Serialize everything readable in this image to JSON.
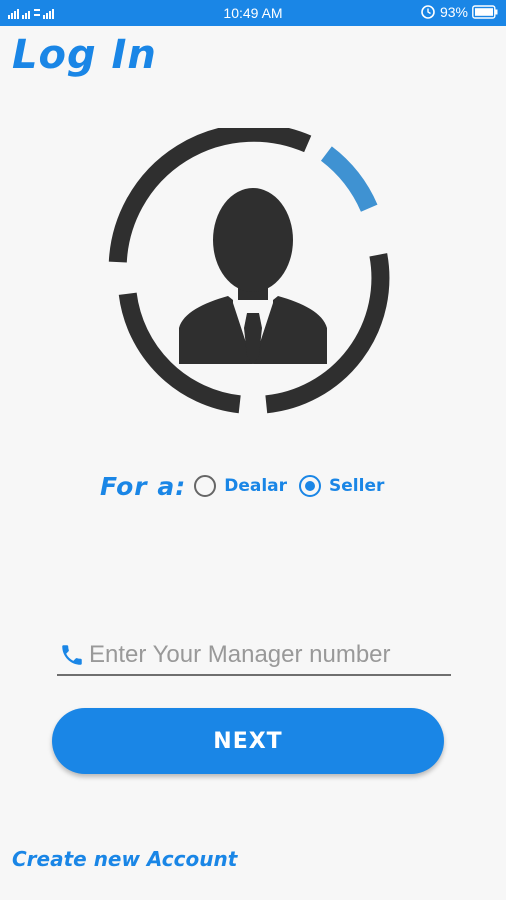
{
  "status_bar": {
    "time": "10:49 AM",
    "battery": "93%",
    "signal_icon": "signal-icon",
    "battery_icon": "battery-icon"
  },
  "title": "Log In",
  "role": {
    "label": "For a:",
    "options": [
      "Dealar",
      "Seller"
    ],
    "selected": "Seller"
  },
  "phone": {
    "placeholder": "Enter Your Manager number",
    "value": "",
    "icon": "phone-icon"
  },
  "next_label": "NEXT",
  "create_account_label": "Create new Account",
  "colors": {
    "accent": "#1a86e6",
    "dark": "#2f2f2f",
    "ring_accent": "#3f92d2",
    "background": "#f7f7f7"
  }
}
